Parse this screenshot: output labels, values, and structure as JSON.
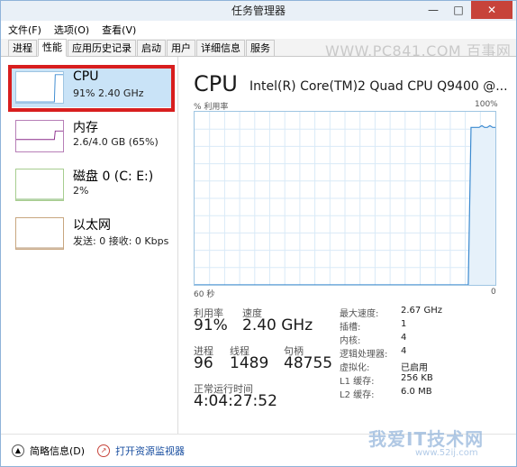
{
  "window": {
    "title": "任务管理器",
    "buttons": {
      "minimize": "—",
      "maximize": "□",
      "close": "✕"
    }
  },
  "menu": [
    "文件(F)",
    "选项(O)",
    "查看(V)"
  ],
  "tabs": [
    {
      "label": "进程",
      "active": false
    },
    {
      "label": "性能",
      "active": true
    },
    {
      "label": "应用历史记录",
      "active": false
    },
    {
      "label": "启动",
      "active": false
    },
    {
      "label": "用户",
      "active": false
    },
    {
      "label": "详细信息",
      "active": false
    },
    {
      "label": "服务",
      "active": false
    }
  ],
  "watermark_top": "WWW.PC841.COM 百事网",
  "resources": [
    {
      "name": "CPU",
      "value": "91% 2.40 GHz",
      "thumb_color": "#3b8ad0"
    },
    {
      "name": "内存",
      "value": "2.6/4.0 GB (65%)",
      "thumb_color": "#8b2d8b"
    },
    {
      "name": "磁盘 0 (C: E:)",
      "value": "2%",
      "thumb_color": "#6aa84f"
    },
    {
      "name": "以太网",
      "value": "发送: 0 接收: 0 Kbps",
      "thumb_color": "#a67c52"
    }
  ],
  "cpu": {
    "title": "CPU",
    "model": "Intel(R) Core(TM)2 Quad CPU Q9400 @...",
    "utilization_label": "% 利用率",
    "max_label": "100%",
    "time_label": "60 秒",
    "min_label": "0"
  },
  "stats": {
    "utilization": {
      "label": "利用率",
      "value": "91%"
    },
    "speed": {
      "label": "速度",
      "value": "2.40 GHz"
    },
    "processes": {
      "label": "进程",
      "value": "96"
    },
    "threads": {
      "label": "线程",
      "value": "1489"
    },
    "handles": {
      "label": "句柄",
      "value": "48755"
    },
    "uptime": {
      "label": "正常运行时间",
      "value": "4:04:27:52"
    }
  },
  "specs": [
    {
      "label": "最大速度:",
      "value": "2.67 GHz"
    },
    {
      "label": "插槽:",
      "value": "1"
    },
    {
      "label": "内核:",
      "value": "4"
    },
    {
      "label": "逻辑处理器:",
      "value": "4"
    },
    {
      "label": "虚拟化:",
      "value": "已启用"
    },
    {
      "label": "L1 缓存:",
      "value": "256 KB"
    },
    {
      "label": "L2 缓存:",
      "value": "6.0 MB"
    }
  ],
  "bottom": {
    "summary": "简略信息(D)",
    "monitor": "打开资源监视器"
  },
  "watermark_br": "我爱IT技术网",
  "watermark_br2": "www.52ij.com",
  "cpu_history_percent": [
    0,
    0,
    0,
    0,
    0,
    0,
    0,
    0,
    0,
    0,
    0,
    0,
    0,
    0,
    0,
    0,
    0,
    0,
    0,
    0,
    0,
    0,
    0,
    0,
    0,
    0,
    0,
    0,
    0,
    0,
    0,
    0,
    0,
    0,
    0,
    0,
    0,
    0,
    0,
    0,
    0,
    0,
    0,
    0,
    0,
    0,
    0,
    0,
    0,
    0,
    0,
    0,
    0,
    0,
    0,
    0,
    0,
    0,
    0,
    0,
    0,
    0,
    0,
    0,
    0,
    0,
    0,
    0,
    0,
    0,
    0,
    0,
    0,
    0,
    0,
    0,
    0,
    0,
    0,
    0,
    0,
    0,
    0,
    0,
    0,
    0,
    0,
    0,
    0,
    0,
    0,
    0,
    0,
    0,
    0,
    0,
    0,
    0,
    0,
    0,
    0,
    0,
    91,
    91,
    91,
    91,
    92,
    91,
    91,
    92,
    91,
    91
  ]
}
